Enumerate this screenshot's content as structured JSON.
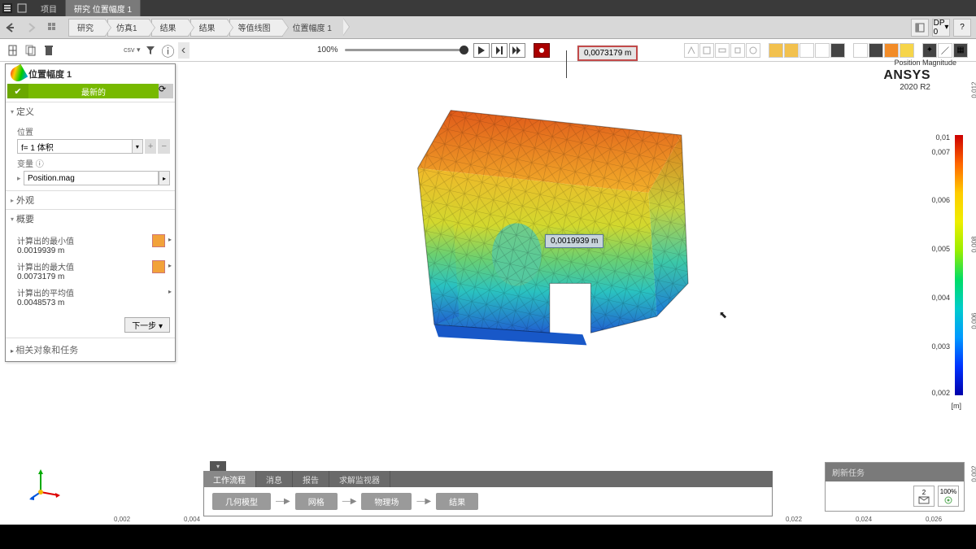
{
  "titlebar": {
    "tabs": [
      {
        "label": "项目"
      },
      {
        "label": "研究 位置幅度 1",
        "active": true
      }
    ]
  },
  "breadcrumb": [
    {
      "label": "研究"
    },
    {
      "label": "仿真1"
    },
    {
      "label": "结果"
    },
    {
      "label": "结果"
    },
    {
      "label": "等值线图"
    },
    {
      "label": "位置幅度 1"
    }
  ],
  "nav": {
    "dp": "DP 0"
  },
  "toolbar": {
    "progress_pct": "100%"
  },
  "props": {
    "title": "位置幅度 1",
    "status": "最新的",
    "sections": {
      "definition": "定义",
      "appearance": "外观",
      "summary": "概要"
    },
    "location": {
      "label": "位置",
      "value": "f= 1 体积"
    },
    "variable": {
      "label": "变量 ⓘ",
      "value": "Position.mag"
    },
    "summary": {
      "min": {
        "label": "计算出的最小值",
        "value": "0.0019939 m"
      },
      "max": {
        "label": "计算出的最大值",
        "value": "0.0073179 m"
      },
      "avg": {
        "label": "计算出的平均值",
        "value": "0.0048573 m"
      }
    },
    "next": "下一步 ▾",
    "related": "相关对象和任务"
  },
  "model": {
    "annotations": {
      "max": "0,0073179 m",
      "min": "0,0019939 m"
    }
  },
  "legend": {
    "title": "Position Magnitude",
    "unit": "[m]",
    "ticks": [
      "0,01",
      "0,007",
      "0,006",
      "0,005",
      "0,004",
      "0,003",
      "0,002"
    ]
  },
  "rulers": {
    "h": [
      {
        "pos": 140,
        "val": "0,002"
      },
      {
        "pos": 226,
        "val": "0,004"
      },
      {
        "pos": 966,
        "val": "0,022"
      },
      {
        "pos": 1052,
        "val": "0,024"
      },
      {
        "pos": 1138,
        "val": "0,026"
      }
    ],
    "v": [
      {
        "pos": 94,
        "val": "0,012"
      },
      {
        "pos": 284,
        "val": "0,008"
      },
      {
        "pos": 378,
        "val": "0,006"
      },
      {
        "pos": 566,
        "val": "0,002"
      }
    ]
  },
  "bottom": {
    "tabs": [
      {
        "label": "工作流程",
        "active": true
      },
      {
        "label": "消息"
      },
      {
        "label": "报告"
      },
      {
        "label": "求解监视器"
      }
    ],
    "workflow": [
      "几何模型",
      "网格",
      "物理场",
      "结果"
    ]
  },
  "refresh": {
    "title": "刷新任务",
    "count": "2",
    "pct": "100%"
  },
  "brand": {
    "name": "ANSYS",
    "version": "2020 R2"
  },
  "csv": "csv ▾"
}
